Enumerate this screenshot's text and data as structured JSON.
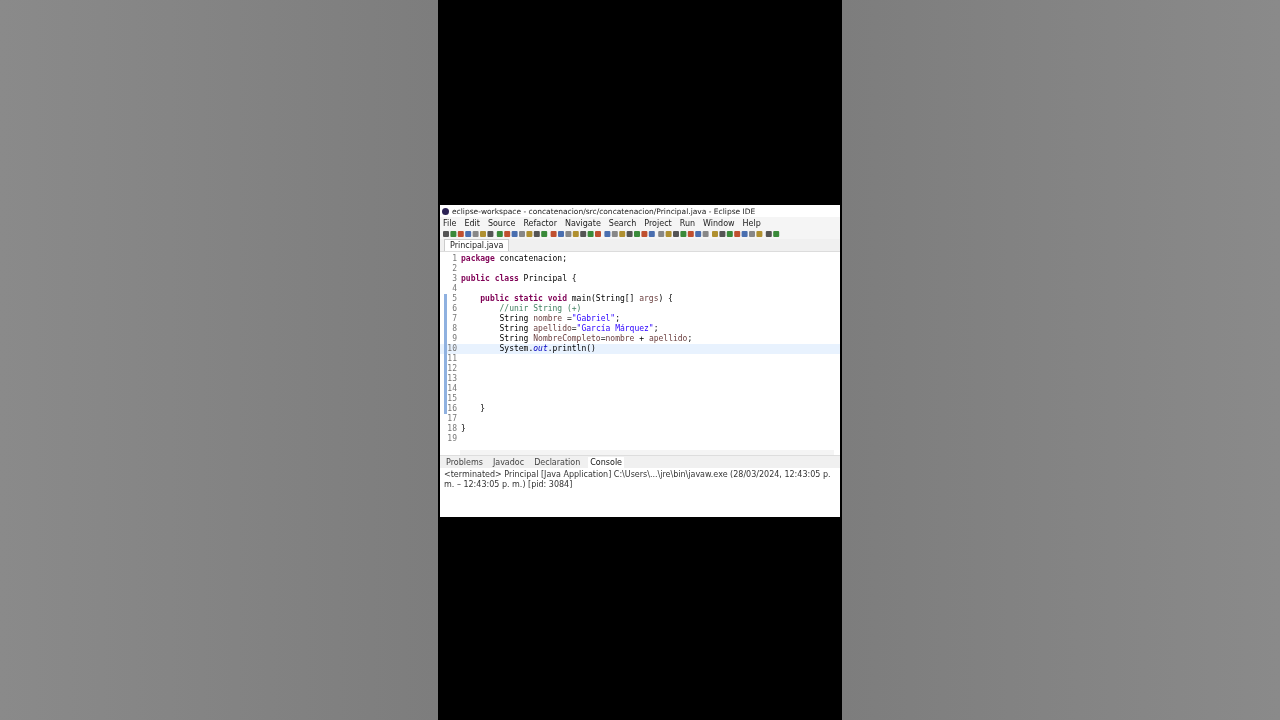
{
  "window": {
    "title": "eclipse-workspace - concatenacion/src/concatenacion/Principal.java - Eclipse IDE"
  },
  "menu": [
    "File",
    "Edit",
    "Source",
    "Refactor",
    "Navigate",
    "Search",
    "Project",
    "Run",
    "Window",
    "Help"
  ],
  "editor_tabs": [
    {
      "label": "Principal.java",
      "selected": true
    }
  ],
  "code_lines": [
    {
      "number": "1",
      "changed": false,
      "current": false,
      "tokens": [
        {
          "kind": "keyword",
          "text": "package"
        },
        {
          "kind": "plain",
          "text": " concatenacion;"
        }
      ]
    },
    {
      "number": "2",
      "changed": false,
      "current": false
    },
    {
      "number": "3",
      "changed": false,
      "current": false,
      "tokens": [
        {
          "kind": "keyword",
          "text": "public class"
        },
        {
          "kind": "plain",
          "text": " Principal {"
        }
      ]
    },
    {
      "number": "4",
      "changed": false,
      "current": false
    },
    {
      "number": "5",
      "changed": true,
      "current": false,
      "tokens": [
        {
          "kind": "keyword",
          "text": "    public static void"
        },
        {
          "kind": "plain",
          "text": " main(String[] "
        },
        {
          "kind": "param",
          "text": "args"
        },
        {
          "kind": "plain",
          "text": ") {"
        }
      ]
    },
    {
      "number": "6",
      "changed": true,
      "current": false,
      "tokens": [
        {
          "kind": "comment",
          "text": "        //unir String (+)"
        }
      ]
    },
    {
      "number": "7",
      "changed": true,
      "current": false,
      "tokens": [
        {
          "kind": "plain",
          "text": "        String "
        },
        {
          "kind": "param",
          "text": "nombre"
        },
        {
          "kind": "plain",
          "text": " ="
        },
        {
          "kind": "string",
          "text": "\"Gabriel\""
        },
        {
          "kind": "plain",
          "text": ";"
        }
      ]
    },
    {
      "number": "8",
      "changed": true,
      "current": false,
      "tokens": [
        {
          "kind": "plain",
          "text": "        String "
        },
        {
          "kind": "param",
          "text": "apellido"
        },
        {
          "kind": "plain",
          "text": "="
        },
        {
          "kind": "string",
          "text": "\"García Márquez\""
        },
        {
          "kind": "plain",
          "text": ";"
        }
      ]
    },
    {
      "number": "9",
      "changed": true,
      "current": false,
      "tokens": [
        {
          "kind": "plain",
          "text": "        String "
        },
        {
          "kind": "param",
          "text": "NombreCompleto"
        },
        {
          "kind": "plain",
          "text": "="
        },
        {
          "kind": "param",
          "text": "nombre"
        },
        {
          "kind": "plain",
          "text": " + "
        },
        {
          "kind": "param",
          "text": "apellido"
        },
        {
          "kind": "plain",
          "text": ";"
        }
      ]
    },
    {
      "number": "10",
      "changed": true,
      "current": true,
      "tokens": [
        {
          "kind": "plain",
          "text": "        System."
        },
        {
          "kind": "field",
          "text": "out"
        },
        {
          "kind": "plain",
          "text": ".println()"
        }
      ]
    },
    {
      "number": "11",
      "changed": true,
      "current": false
    },
    {
      "number": "12",
      "changed": true,
      "current": false
    },
    {
      "number": "13",
      "changed": true,
      "current": false
    },
    {
      "number": "14",
      "changed": true,
      "current": false
    },
    {
      "number": "15",
      "changed": true,
      "current": false
    },
    {
      "number": "16",
      "changed": true,
      "current": false,
      "tokens": [
        {
          "kind": "plain",
          "text": "    }"
        }
      ]
    },
    {
      "number": "17",
      "changed": false,
      "current": false
    },
    {
      "number": "18",
      "changed": false,
      "current": false,
      "tokens": [
        {
          "kind": "plain",
          "text": "}"
        }
      ]
    },
    {
      "number": "19",
      "changed": false,
      "current": false
    }
  ],
  "bottom_tabs": [
    {
      "label": "Problems",
      "selected": false
    },
    {
      "label": "Javadoc",
      "selected": false
    },
    {
      "label": "Declaration",
      "selected": false
    },
    {
      "label": "Console",
      "selected": true
    }
  ],
  "console": {
    "status": "<terminated> Principal [Java Application] C:\\Users\\...\\jre\\bin\\javaw.exe (28/03/2024, 12:43:05 p. m. – 12:43:05 p. m.) [pid: 3084]"
  }
}
